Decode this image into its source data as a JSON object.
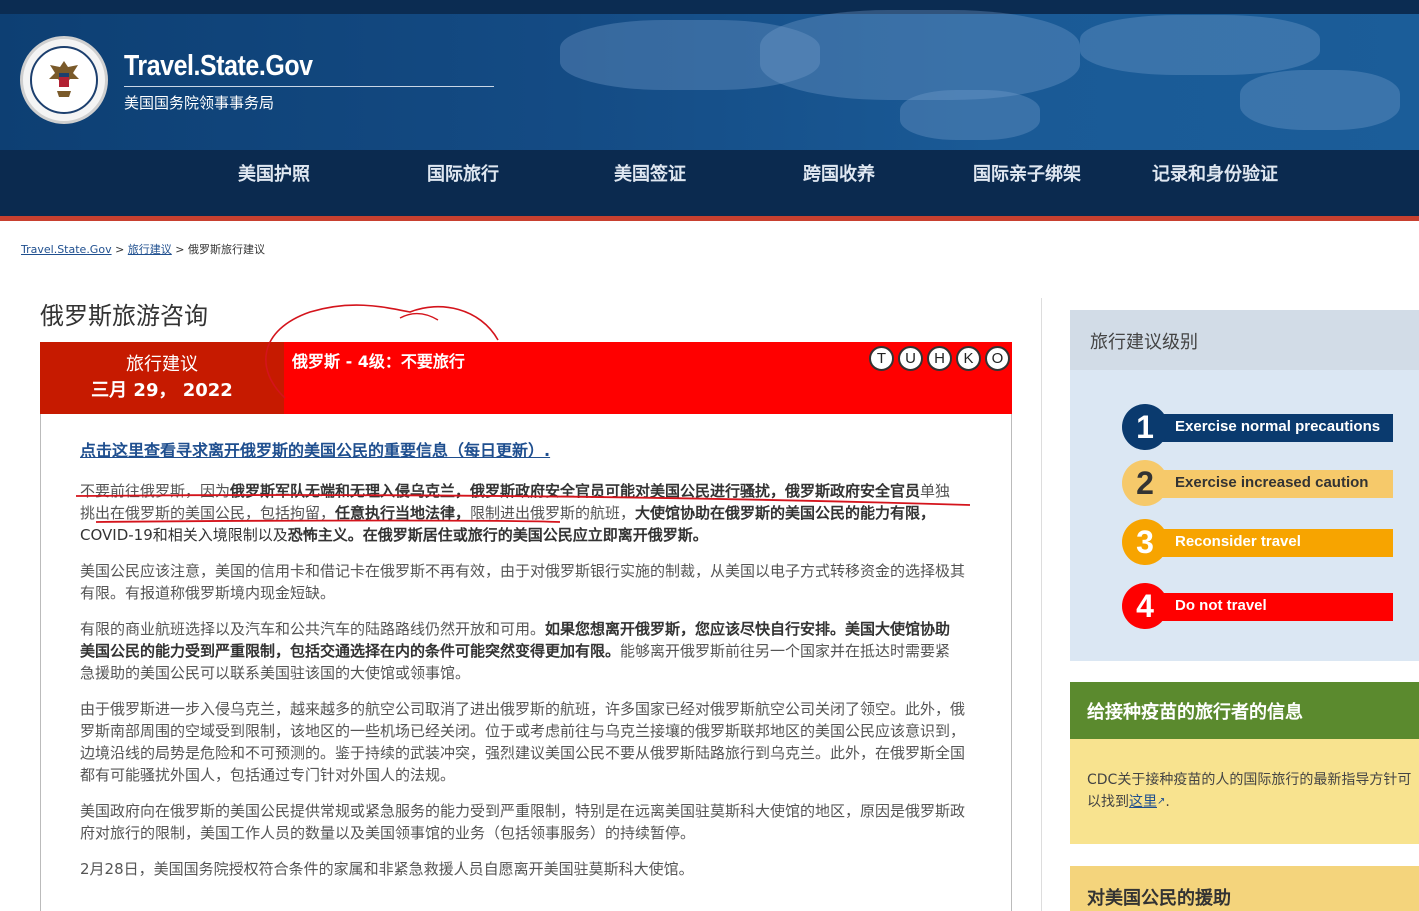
{
  "header": {
    "site_title": "Travel.State.Gov",
    "site_subtitle": "美国国务院领事事务局",
    "seal_icon": "department-of-state-seal"
  },
  "nav": {
    "items": [
      {
        "label": "美国护照"
      },
      {
        "label": "国际旅行"
      },
      {
        "label": "美国签证"
      },
      {
        "label": "跨国收养"
      },
      {
        "label": "国际亲子绑架"
      },
      {
        "label": "记录和身份验证"
      }
    ]
  },
  "breadcrumb": {
    "home": "Travel.State.Gov",
    "sep1": " > ",
    "section": "旅行建议",
    "sep2": " > ",
    "current": "俄罗斯旅行建议"
  },
  "page_title": "俄罗斯旅游咨询",
  "advisory": {
    "label": "旅行建议",
    "date": "三月 29， 2022",
    "level_text": "俄罗斯 - 4级：不要旅行",
    "badges": [
      "T",
      "U",
      "H",
      "K",
      "O"
    ]
  },
  "content": {
    "link": "点击这里查看寻求离开俄罗斯的美国公民的重要信息（每日更新）.",
    "p1_a": "不要前往俄罗斯，因为",
    "p1_b": "俄罗斯军队无端和无理入侵乌克兰，俄罗斯政府安全官员可能对美国公民进行骚扰，俄罗斯政府安全官员",
    "p1_c": "单独挑出在俄罗斯的美国公民，包括拘留，",
    "p1_d": "任意执行当地法律，",
    "p1_e": "限制进出俄罗斯的航班，",
    "p1_f": "大使馆协助在俄罗斯的美国公民的能力有限，",
    "p1_g": "COVID-19和相关入境限制以及",
    "p1_h": "恐怖主义。在俄罗斯居住或旅行的美国公民应立即离开俄罗斯。",
    "p2": "美国公民应该注意，美国的信用卡和借记卡在俄罗斯不再有效，由于对俄罗斯银行实施的制裁，从美国以电子方式转移资金的选择极其有限。有报道称俄罗斯境内现金短缺。",
    "p3_a": "有限的商业航班选择以及汽车和公共汽车的陆路路线仍然开放和可用。",
    "p3_b": "如果您想离开俄罗斯，您应该尽快自行安排。美国大使馆协助美国公民的能力受到严重限制，包括交通选择在内的条件可能突然变得更加有限。",
    "p3_c": "能够离开俄罗斯前往另一个国家并在抵达时需要紧急援助的美国公民可以联系美国驻该国的大使馆或领事馆。",
    "p4": "由于俄罗斯进一步入侵乌克兰，越来越多的航空公司取消了进出俄罗斯的航班，许多国家已经对俄罗斯航空公司关闭了领空。此外，俄罗斯南部周围的空域受到限制，该地区的一些机场已经关闭。位于或考虑前往与乌克兰接壤的俄罗斯联邦地区的美国公民应该意识到，边境沿线的局势是危险和不可预测的。鉴于持续的武装冲突，强烈建议美国公民不要从俄罗斯陆路旅行到乌克兰。此外，在俄罗斯全国都有可能骚扰外国人，包括通过专门针对外国人的法规。",
    "p5": "美国政府向在俄罗斯的美国公民提供常规或紧急服务的能力受到严重限制，特别是在远离美国驻莫斯科大使馆的地区，原因是俄罗斯政府对旅行的限制，美国工作人员的数量以及美国领事馆的业务（包括领事服务）的持续暂停。",
    "p6": "2月28日，美国国务院授权符合条件的家属和非紧急救援人员自愿离开美国驻莫斯科大使馆。"
  },
  "sidebar": {
    "levels_title": "旅行建议级别",
    "levels": [
      {
        "num": "1",
        "label": "Exercise normal precautions",
        "color": "#0a3a6e",
        "text_color": "#ffffff"
      },
      {
        "num": "2",
        "label": "Exercise increased caution",
        "color": "#f6c96a",
        "text_color": "#333333"
      },
      {
        "num": "3",
        "label": "Reconsider travel",
        "color": "#f7a400",
        "text_color": "#ffffff"
      },
      {
        "num": "4",
        "label": "Do not travel",
        "color": "#ff0000",
        "text_color": "#ffffff"
      }
    ],
    "vaccine_title": "给接种疫苗的旅行者的信息",
    "vaccine_body": "CDC关于接种疫苗的人的国际旅行的最新指导方针可以找到",
    "vaccine_link": "这里",
    "vaccine_tail": ".",
    "assist_title": "对美国公民的援助"
  }
}
